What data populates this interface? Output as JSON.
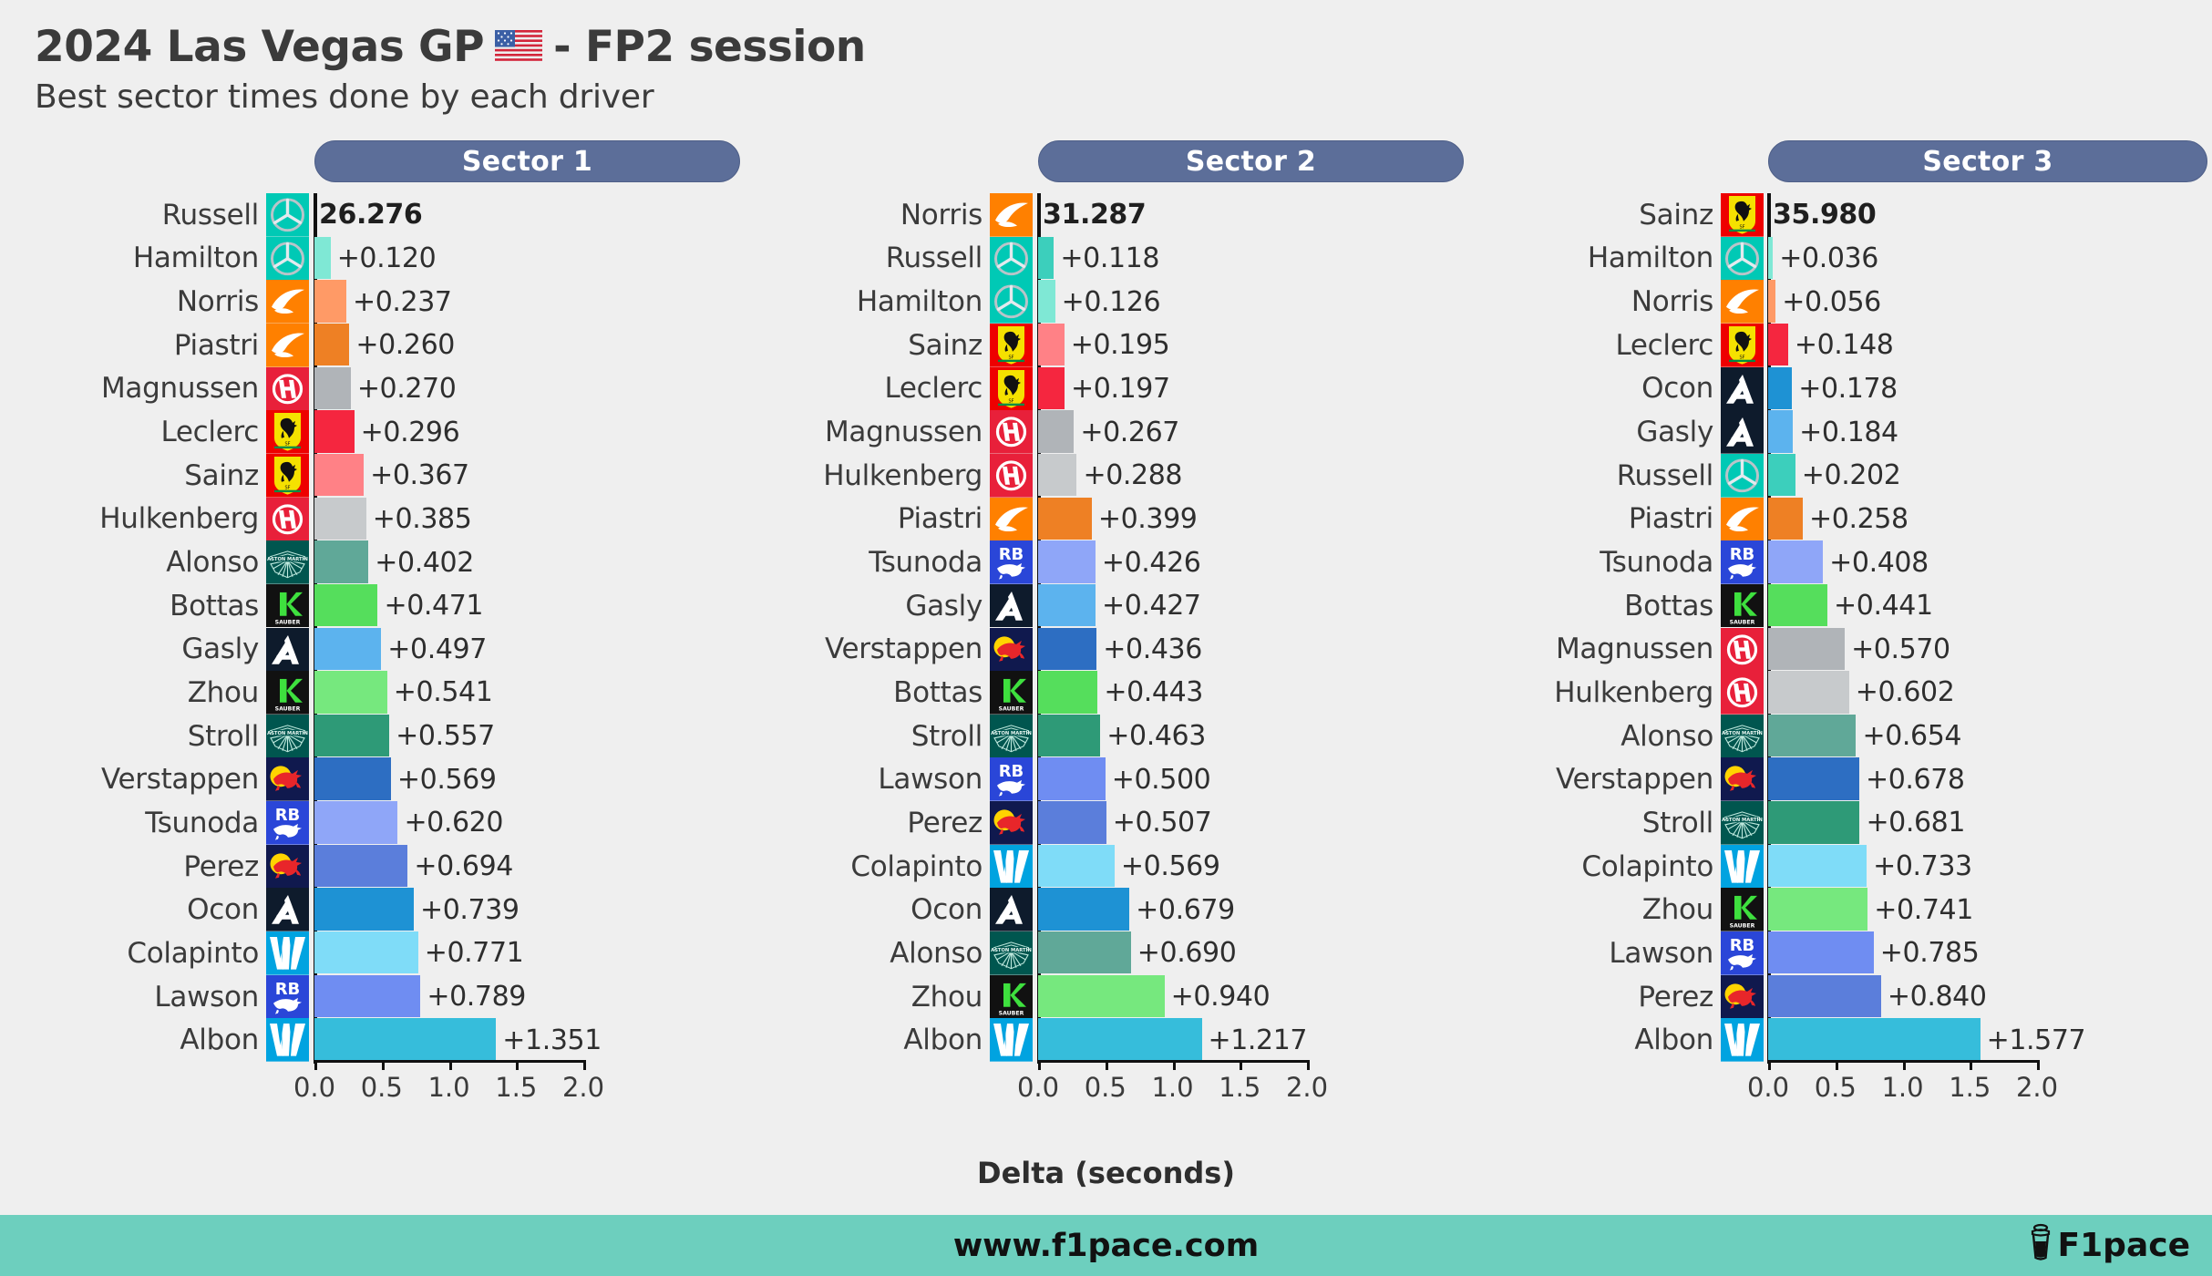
{
  "header": {
    "title_prefix": "2024 Las Vegas GP",
    "flag": "us-flag",
    "title_suffix": "- FP2 session",
    "subtitle": "Best sector times done by each driver"
  },
  "axis": {
    "xlabel": "Delta (seconds)",
    "ticks": [
      "0.0",
      "0.5",
      "1.0",
      "1.5",
      "2.0"
    ],
    "tick_values": [
      0.0,
      0.5,
      1.0,
      1.5,
      2.0
    ],
    "xmin": 0.0,
    "xmax": 2.2
  },
  "footer": {
    "url": "www.f1pace.com",
    "brand": "F1pace",
    "brand_icon": "coffee-cup-icon",
    "background": "#6DCFBE"
  },
  "colors": {
    "background": "#EFEFEF",
    "header_bar": "#5C6E99",
    "text": "#3B3B3B"
  },
  "chart_data": {
    "type": "bar",
    "title": "2024 Las Vegas GP - FP2 session",
    "subtitle": "Best sector times done by each driver",
    "xlabel": "Delta (seconds)",
    "ylabel": "",
    "xlim": [
      0.0,
      2.2
    ],
    "grid": false,
    "legend": "none",
    "orientation": "horizontal",
    "panels": [
      {
        "label": "Sector 1",
        "leader_time": "26.276",
        "categories": [
          "Russell",
          "Hamilton",
          "Norris",
          "Piastri",
          "Magnussen",
          "Leclerc",
          "Sainz",
          "Hulkenberg",
          "Alonso",
          "Bottas",
          "Gasly",
          "Zhou",
          "Stroll",
          "Verstappen",
          "Tsunoda",
          "Perez",
          "Ocon",
          "Colapinto",
          "Lawson",
          "Albon"
        ],
        "values": [
          0.0,
          0.12,
          0.237,
          0.26,
          0.27,
          0.296,
          0.367,
          0.385,
          0.402,
          0.471,
          0.497,
          0.541,
          0.557,
          0.569,
          0.62,
          0.694,
          0.739,
          0.771,
          0.789,
          1.351
        ],
        "labels": [
          "26.276",
          "+0.120",
          "+0.237",
          "+0.260",
          "+0.270",
          "+0.296",
          "+0.367",
          "+0.385",
          "+0.402",
          "+0.471",
          "+0.497",
          "+0.541",
          "+0.557",
          "+0.569",
          "+0.620",
          "+0.694",
          "+0.739",
          "+0.771",
          "+0.789",
          "+1.351"
        ],
        "teams": [
          "mercedes",
          "mercedes",
          "mclaren",
          "mclaren",
          "haas",
          "ferrari",
          "ferrari",
          "haas",
          "astonmartin",
          "sauber",
          "alpine",
          "sauber",
          "astonmartin",
          "redbull",
          "rb",
          "redbull",
          "alpine",
          "williams",
          "rb",
          "williams"
        ],
        "bar_colors": [
          "#00D2BE",
          "#7FE8D5",
          "#FF9A66",
          "#EE8024",
          "#B0B4B8",
          "#F5263F",
          "#FF8186",
          "#C7CACC",
          "#60A898",
          "#55DE5C",
          "#5CB3EE",
          "#76E87E",
          "#2E9A77",
          "#2D6EC2",
          "#8FA6F8",
          "#5B7EDB",
          "#1E92D4",
          "#7FDCF8",
          "#6F8DF2",
          "#36BDDB"
        ]
      },
      {
        "label": "Sector 2",
        "leader_time": "31.287",
        "categories": [
          "Norris",
          "Russell",
          "Hamilton",
          "Sainz",
          "Leclerc",
          "Magnussen",
          "Hulkenberg",
          "Piastri",
          "Tsunoda",
          "Gasly",
          "Verstappen",
          "Bottas",
          "Stroll",
          "Lawson",
          "Perez",
          "Colapinto",
          "Ocon",
          "Alonso",
          "Zhou",
          "Albon"
        ],
        "values": [
          0.0,
          0.118,
          0.126,
          0.195,
          0.197,
          0.267,
          0.288,
          0.399,
          0.426,
          0.427,
          0.436,
          0.443,
          0.463,
          0.5,
          0.507,
          0.569,
          0.679,
          0.69,
          0.94,
          1.217
        ],
        "labels": [
          "31.287",
          "+0.118",
          "+0.126",
          "+0.195",
          "+0.197",
          "+0.267",
          "+0.288",
          "+0.399",
          "+0.426",
          "+0.427",
          "+0.436",
          "+0.443",
          "+0.463",
          "+0.500",
          "+0.507",
          "+0.569",
          "+0.679",
          "+0.690",
          "+0.940",
          "+1.217"
        ],
        "teams": [
          "mclaren",
          "mercedes",
          "mercedes",
          "ferrari",
          "ferrari",
          "haas",
          "haas",
          "mclaren",
          "rb",
          "alpine",
          "redbull",
          "sauber",
          "astonmartin",
          "rb",
          "redbull",
          "williams",
          "alpine",
          "astonmartin",
          "sauber",
          "williams"
        ],
        "bar_colors": [
          "#EE8024",
          "#3CCFBC",
          "#7FE8D5",
          "#FF8186",
          "#F5263F",
          "#B0B4B8",
          "#C7CACC",
          "#EE8024",
          "#8FA6F8",
          "#5CB3EE",
          "#2D6EC2",
          "#55DE5C",
          "#2E9A77",
          "#6F8DF2",
          "#5B7EDB",
          "#7FDCF8",
          "#1E92D4",
          "#60A898",
          "#76E87E",
          "#36BDDB"
        ]
      },
      {
        "label": "Sector 3",
        "leader_time": "35.980",
        "categories": [
          "Sainz",
          "Hamilton",
          "Norris",
          "Leclerc",
          "Ocon",
          "Gasly",
          "Russell",
          "Piastri",
          "Tsunoda",
          "Bottas",
          "Magnussen",
          "Hulkenberg",
          "Alonso",
          "Verstappen",
          "Stroll",
          "Colapinto",
          "Zhou",
          "Lawson",
          "Perez",
          "Albon"
        ],
        "values": [
          0.0,
          0.036,
          0.056,
          0.148,
          0.178,
          0.184,
          0.202,
          0.258,
          0.408,
          0.441,
          0.57,
          0.602,
          0.654,
          0.678,
          0.681,
          0.733,
          0.741,
          0.785,
          0.84,
          1.577
        ],
        "labels": [
          "35.980",
          "+0.036",
          "+0.056",
          "+0.148",
          "+0.178",
          "+0.184",
          "+0.202",
          "+0.258",
          "+0.408",
          "+0.441",
          "+0.570",
          "+0.602",
          "+0.654",
          "+0.678",
          "+0.681",
          "+0.733",
          "+0.741",
          "+0.785",
          "+0.840",
          "+1.577"
        ],
        "teams": [
          "ferrari",
          "mercedes",
          "mclaren",
          "ferrari",
          "alpine",
          "alpine",
          "mercedes",
          "mclaren",
          "rb",
          "sauber",
          "haas",
          "haas",
          "astonmartin",
          "redbull",
          "astonmartin",
          "williams",
          "sauber",
          "rb",
          "redbull",
          "williams"
        ],
        "bar_colors": [
          "#FF8186",
          "#7FE8D5",
          "#FF9A66",
          "#F5263F",
          "#1E92D4",
          "#5CB3EE",
          "#3CCFBC",
          "#EE8024",
          "#8FA6F8",
          "#55DE5C",
          "#B0B4B8",
          "#C7CACC",
          "#60A898",
          "#2D6EC2",
          "#2E9A77",
          "#7FDCF8",
          "#76E87E",
          "#6F8DF2",
          "#5B7EDB",
          "#36BDDB"
        ]
      }
    ]
  }
}
